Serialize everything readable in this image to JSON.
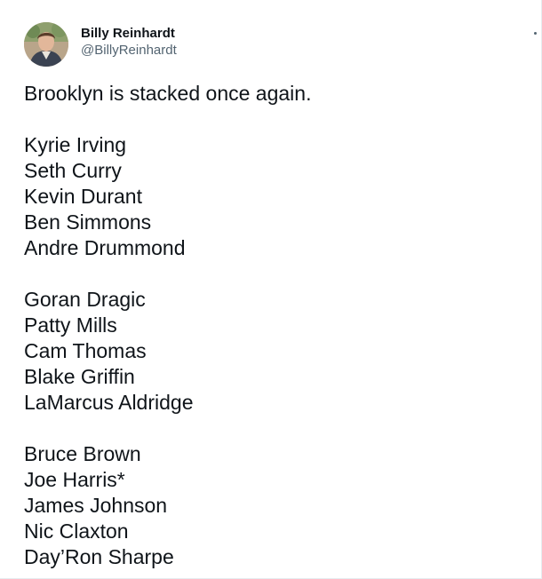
{
  "tweet": {
    "author": {
      "display_name": "Billy Reinhardt",
      "handle": "@BillyReinhardt"
    },
    "text": {
      "intro": "Brooklyn is stacked once again.",
      "group1": [
        "Kyrie Irving",
        "Seth Curry",
        "Kevin Durant",
        "Ben Simmons",
        "Andre Drummond"
      ],
      "group2": [
        "Goran Dragic",
        "Patty Mills",
        "Cam Thomas",
        "Blake Griffin",
        "LaMarcus Aldridge"
      ],
      "group3": [
        "Bruce Brown",
        "Joe Harris*",
        "James Johnson",
        "Nic Claxton",
        "Day’Ron Sharpe"
      ]
    },
    "menu_icon": "more-options-icon"
  },
  "colors": {
    "text_primary": "#0f1419",
    "text_secondary": "#536471"
  }
}
